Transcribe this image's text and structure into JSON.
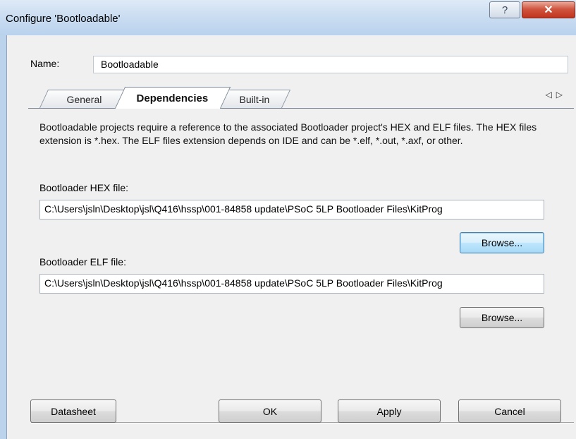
{
  "window": {
    "title": "Configure 'Bootloadable'",
    "help_glyph": "?",
    "close_glyph": "✕"
  },
  "name_field": {
    "label": "Name:",
    "value": "Bootloadable"
  },
  "tabs": [
    {
      "label": "General"
    },
    {
      "label": "Dependencies"
    },
    {
      "label": "Built-in"
    }
  ],
  "tab_scroll": {
    "left_glyph": "◁",
    "right_glyph": "▷"
  },
  "dependencies": {
    "description": "Bootloadable projects require a reference to the associated Bootloader project's HEX and ELF files. The HEX files extension is *.hex. The ELF files extension depends on IDE and can be *.elf, *.out, *.axf, or other.",
    "hex": {
      "label": "Bootloader HEX file:",
      "value": "C:\\Users\\jsln\\Desktop\\jsl\\Q416\\hssp\\001-84858 update\\PSoC 5LP Bootloader Files\\KitProg",
      "browse_label": "Browse..."
    },
    "elf": {
      "label": "Bootloader ELF file:",
      "value": "C:\\Users\\jsln\\Desktop\\jsl\\Q416\\hssp\\001-84858 update\\PSoC 5LP Bootloader Files\\KitProg",
      "browse_label": "Browse..."
    }
  },
  "footer": {
    "datasheet_label": "Datasheet",
    "ok_label": "OK",
    "apply_label": "Apply",
    "cancel_label": "Cancel"
  }
}
